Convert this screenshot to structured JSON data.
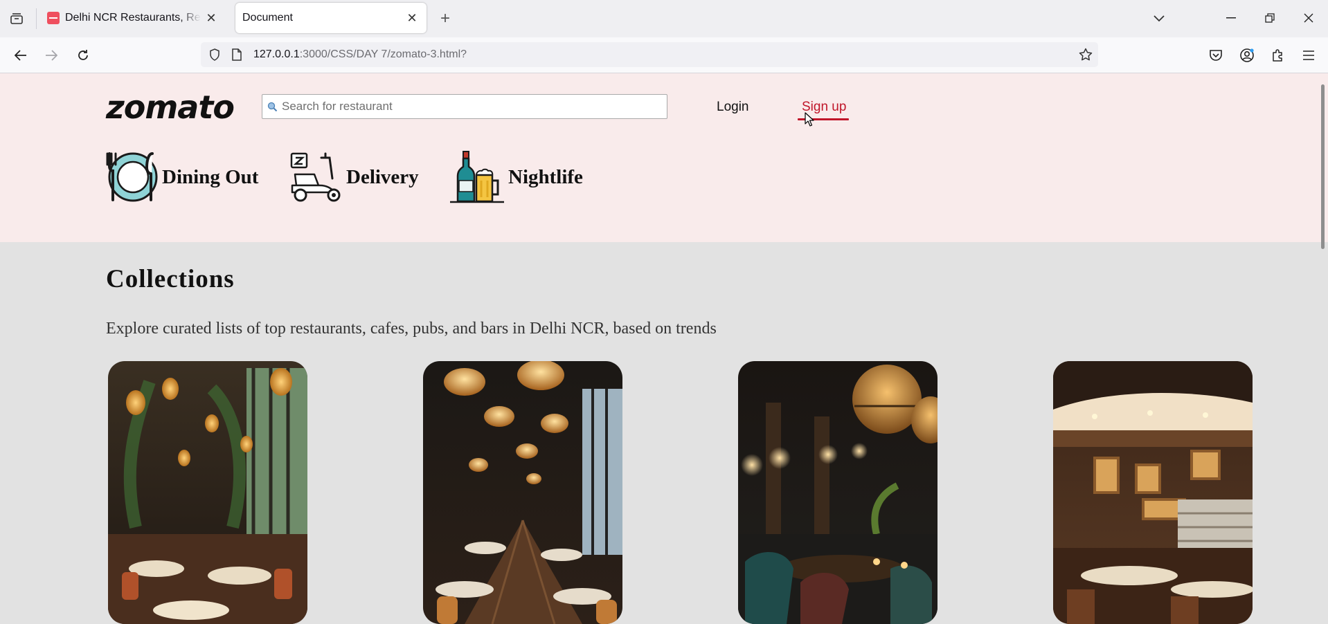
{
  "browser": {
    "tabs": [
      {
        "title": "Delhi NCR Restaurants, Restaurants in Delhi NCR",
        "active": false
      },
      {
        "title": "Document",
        "active": true
      }
    ],
    "url_host": "127.0.0.1",
    "url_path": ":3000/CSS/DAY 7/zomato-3.html?"
  },
  "header": {
    "logo": "zomato",
    "search_placeholder": "Search for restaurant",
    "login": "Login",
    "signup": "Sign up",
    "categories": [
      {
        "label": "Dining Out",
        "icon": "dining-plate-icon"
      },
      {
        "label": "Delivery",
        "icon": "delivery-scooter-icon"
      },
      {
        "label": "Nightlife",
        "icon": "wine-beer-icon"
      }
    ]
  },
  "collections": {
    "title": "Collections",
    "subtitle": "Explore curated lists of top restaurants, cafes, pubs, and bars in Delhi NCR, based on trends"
  },
  "colors": {
    "brand_red": "#c0162a",
    "header_bg": "#f9ebeb",
    "page_bg": "#e2e2e2"
  }
}
